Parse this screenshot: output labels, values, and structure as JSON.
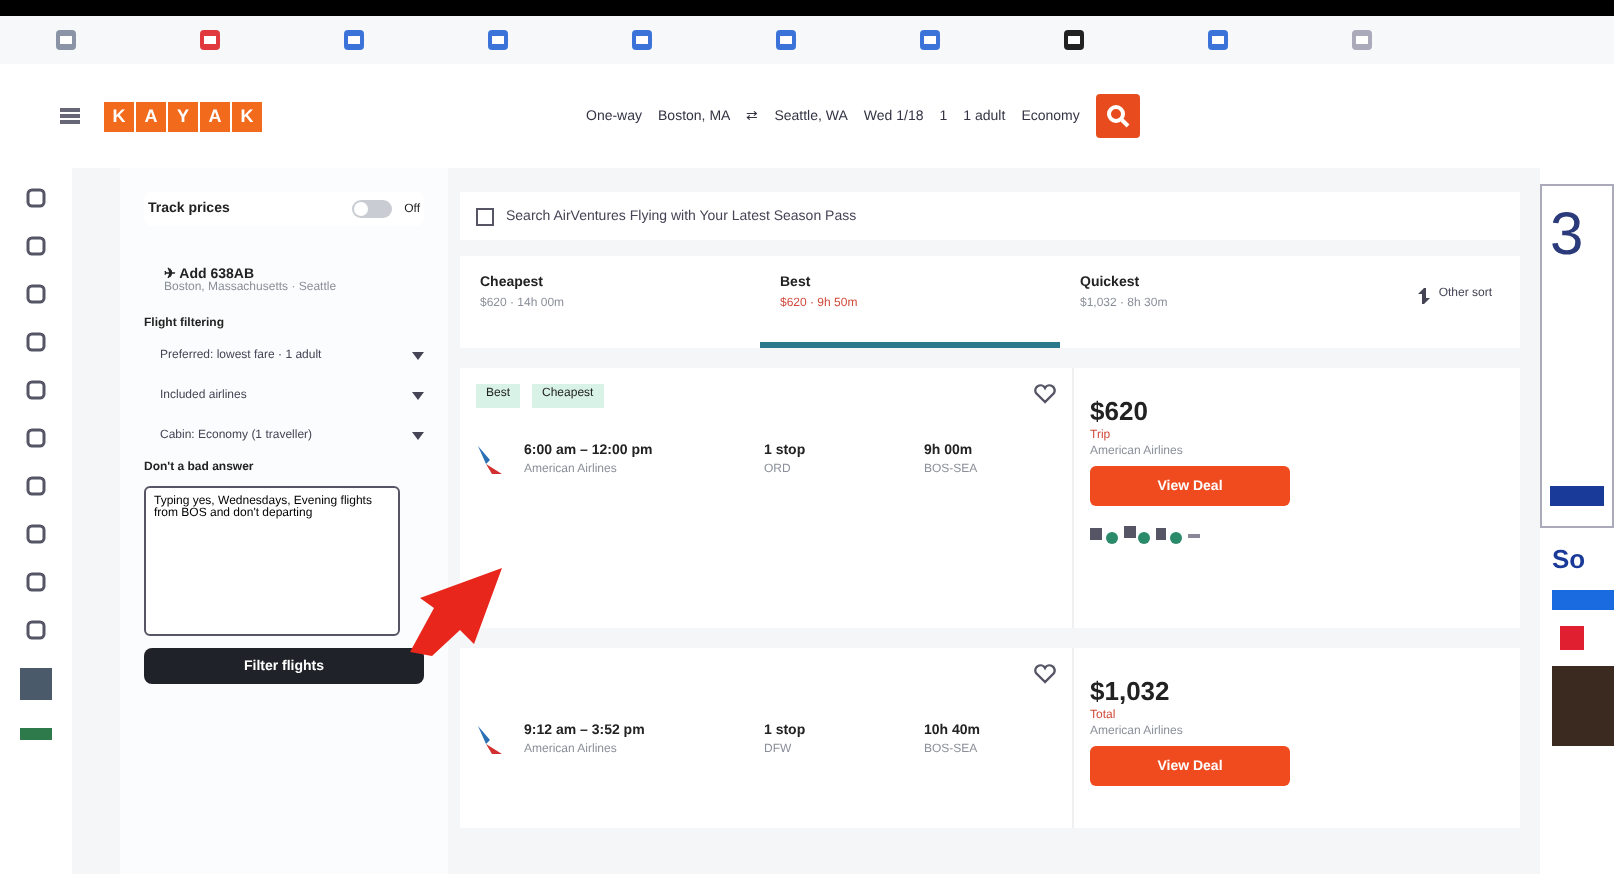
{
  "header": {
    "logo": [
      "K",
      "A",
      "Y",
      "A",
      "K"
    ],
    "search": [
      "One-way",
      "Boston, MA",
      "⇄",
      "Seattle, WA",
      "Wed 1/18",
      "1",
      "1 adult",
      "Economy"
    ]
  },
  "sidebar": {
    "track": {
      "label": "Track prices",
      "on": false,
      "state": "Off"
    },
    "trip": {
      "title": "✈ Add 638AB",
      "sub": "Boston, Massachusetts · Seattle"
    },
    "section": "Flight filtering",
    "dropdowns": [
      "Preferred: lowest fare · 1 adult",
      "Included airlines",
      "Cabin: Economy (1 traveller)"
    ],
    "prompt_label": "Don't a bad answer",
    "prompt_value": "Typing yes, Wednesdays, Evening flights from BOS and don't departing",
    "button": "Filter flights"
  },
  "banner": "Search AirVentures Flying with Your Latest Season Pass",
  "tabs": [
    {
      "label": "Cheapest",
      "sub": "$620 · 14h 00m",
      "selected": false
    },
    {
      "label": "Best",
      "sub": "$620 · 9h 50m",
      "selected": true
    },
    {
      "label": "Quickest",
      "sub": "$1,032 · 8h 30m",
      "selected": false
    }
  ],
  "other_sort": "Other sort",
  "results": [
    {
      "tags": [
        "Best",
        "Cheapest"
      ],
      "times": "6:00 am – 12:00 pm",
      "airline": "American Airlines",
      "stops": "1 stop",
      "via": "ORD",
      "duration": "9h 00m",
      "route": "BOS-SEA",
      "price": "$620",
      "price_note": "Trip",
      "seller": "American Airlines",
      "deal": "View Deal",
      "amenities": true
    },
    {
      "times": "9:12 am – 3:52 pm",
      "airline": "American Airlines",
      "stops": "1 stop",
      "via": "DFW",
      "duration": "10h 40m",
      "route": "BOS-SEA",
      "price": "$1,032",
      "price_note": "Total",
      "seller": "American Airlines",
      "deal": "View Deal",
      "amenities": false
    }
  ],
  "ad": {
    "big": "3",
    "headline": "So"
  }
}
